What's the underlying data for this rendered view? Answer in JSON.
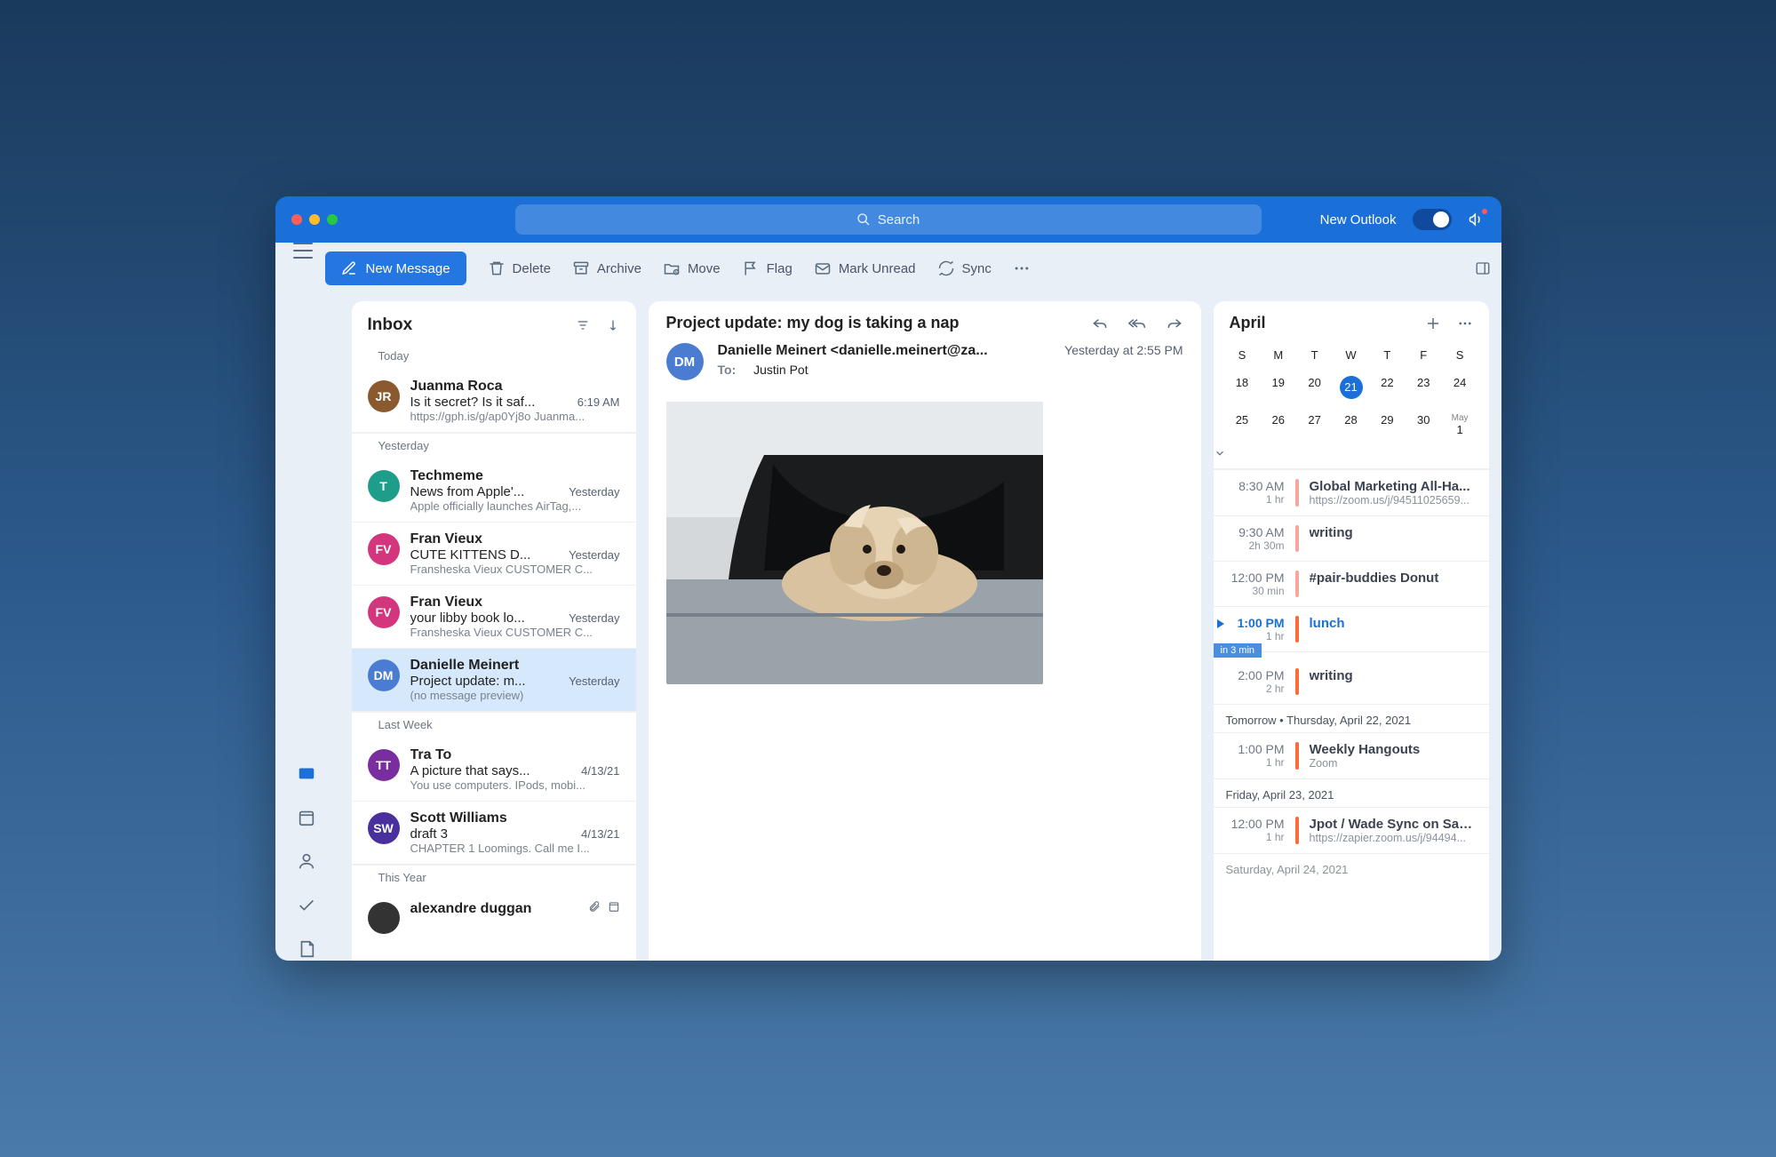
{
  "titlebar": {
    "search_label": "Search",
    "new_outlook": "New Outlook"
  },
  "toolbar": {
    "new_message": "New Message",
    "delete": "Delete",
    "archive": "Archive",
    "move": "Move",
    "flag": "Flag",
    "mark_unread": "Mark Unread",
    "sync": "Sync"
  },
  "list": {
    "title": "Inbox",
    "sections": {
      "today": "Today",
      "yesterday": "Yesterday",
      "last_week": "Last Week",
      "this_year": "This Year"
    },
    "messages": [
      {
        "avatar_text": "JR",
        "avatar_color": "#8a5a2e",
        "sender": "Juanma Roca",
        "subject": "Is it secret? Is it saf...",
        "date": "6:19 AM",
        "preview": "https://gph.is/g/ap0Yj8o Juanma..."
      },
      {
        "avatar_text": "T",
        "avatar_color": "#1e9e8a",
        "sender": "Techmeme",
        "subject": "News from Apple'...",
        "date": "Yesterday",
        "preview": "Apple officially launches AirTag,..."
      },
      {
        "avatar_text": "FV",
        "avatar_color": "#d4367e",
        "sender": "Fran Vieux",
        "subject": "CUTE KITTENS D...",
        "date": "Yesterday",
        "preview": "Fransheska Vieux CUSTOMER C..."
      },
      {
        "avatar_text": "FV",
        "avatar_color": "#d4367e",
        "sender": "Fran Vieux",
        "subject": "your libby book lo...",
        "date": "Yesterday",
        "preview": "Fransheska Vieux CUSTOMER C..."
      },
      {
        "avatar_text": "DM",
        "avatar_color": "#4a7dd1",
        "sender": "Danielle Meinert",
        "subject": "Project update: m...",
        "date": "Yesterday",
        "preview": "(no message preview)"
      },
      {
        "avatar_text": "TT",
        "avatar_color": "#7a2d9e",
        "sender": "Tra To",
        "subject": "A picture that says...",
        "date": "4/13/21",
        "preview": "You use computers. IPods, mobi..."
      },
      {
        "avatar_text": "SW",
        "avatar_color": "#4a2f9e",
        "sender": "Scott Williams",
        "subject": "draft 3",
        "date": "4/13/21",
        "preview": "CHAPTER 1 Loomings. Call me I..."
      },
      {
        "avatar_text": "",
        "avatar_color": "#333",
        "sender": "alexandre duggan",
        "subject": "",
        "date": "",
        "preview": ""
      }
    ]
  },
  "reader": {
    "subject": "Project update: my dog is taking a nap",
    "avatar_text": "DM",
    "from_line": "Danielle Meinert <danielle.meinert@za...",
    "to_label": "To:",
    "to_value": "Justin Pot",
    "datetime": "Yesterday at 2:55 PM"
  },
  "calendar": {
    "month": "April",
    "dow": [
      "S",
      "M",
      "T",
      "W",
      "T",
      "F",
      "S"
    ],
    "rows": [
      [
        "18",
        "19",
        "20",
        "21",
        "22",
        "23",
        "24"
      ],
      [
        "25",
        "26",
        "27",
        "28",
        "29",
        "30",
        "1"
      ]
    ],
    "today_col": 3,
    "may_label": "May",
    "agenda": [
      {
        "t1": "8:30 AM",
        "t2": "1 hr",
        "bar": "tentative",
        "title": "Global Marketing All-Ha...",
        "sub": "https://zoom.us/j/94511025659..."
      },
      {
        "t1": "9:30 AM",
        "t2": "2h 30m",
        "bar": "tentative",
        "title": "writing",
        "sub": ""
      },
      {
        "t1": "12:00 PM",
        "t2": "30 min",
        "bar": "tentative",
        "title": "#pair-buddies Donut",
        "sub": ""
      },
      {
        "t1": "1:00 PM",
        "t2": "1 hr",
        "bar": "busy",
        "title": "lunch",
        "sub": "",
        "current": true
      },
      {
        "t1": "2:00 PM",
        "t2": "2 hr",
        "bar": "busy",
        "title": "writing",
        "sub": "",
        "banner": "in 3 min"
      }
    ],
    "tomorrow_label": "Tomorrow  •  Thursday, April 22, 2021",
    "tomorrow": [
      {
        "t1": "1:00 PM",
        "t2": "1 hr",
        "bar": "busy",
        "title": "Weekly Hangouts",
        "sub": "Zoom"
      }
    ],
    "friday_label": "Friday, April 23, 2021",
    "friday": [
      {
        "t1": "12:00 PM",
        "t2": "1 hr",
        "bar": "busy",
        "title": "Jpot / Wade Sync on Sac...",
        "sub": "https://zapier.zoom.us/j/94494..."
      }
    ],
    "saturday_label": "Saturday, April 24, 2021"
  }
}
